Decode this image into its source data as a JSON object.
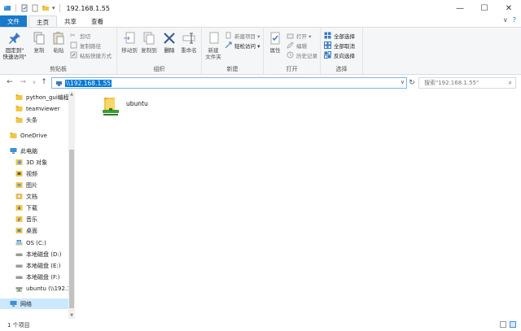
{
  "window": {
    "title": "192.168.1.55",
    "controls": {
      "minimize": "—",
      "maximize": "☐",
      "close": "✕"
    }
  },
  "ribbon_tabs": [
    {
      "label": "文件"
    },
    {
      "label": "主页"
    },
    {
      "label": "共享"
    },
    {
      "label": "查看"
    }
  ],
  "ribbon_right": {
    "collapse": "∨",
    "help": "?"
  },
  "ribbon": {
    "clipboard": {
      "label": "剪贴板",
      "pin": "固定到\"\n快速访问\"",
      "copy": "复制",
      "paste": "粘贴",
      "cut": "剪切",
      "copy_path": "复制路径",
      "paste_shortcut": "粘贴快捷方式"
    },
    "organize": {
      "label": "组织",
      "move_to": "移动到",
      "copy_to": "复制到",
      "delete": "删除",
      "rename": "重命名"
    },
    "new": {
      "label": "新建",
      "new_folder": "新建\n文件夹",
      "new_item": "新建项目 ▾",
      "easy_access": "轻松访问 ▾"
    },
    "open": {
      "label": "打开",
      "properties": "属性",
      "open": "打开 ▾",
      "edit": "编辑",
      "history": "历史记录"
    },
    "select": {
      "label": "选择",
      "select_all": "全部选择",
      "select_none": "全部取消",
      "invert": "反向选择"
    }
  },
  "address": {
    "path": "\\\\192.168.1.55",
    "search_placeholder": "搜索\"192.168.1.55\""
  },
  "nav": {
    "back": "←",
    "forward": "→",
    "recent": "∨",
    "up": "↑",
    "refresh": "↻"
  },
  "tree": [
    {
      "label": "python_gui编程"
    },
    {
      "label": "teamviewer"
    },
    {
      "label": "头条"
    },
    {
      "label": "OneDrive"
    },
    {
      "label": "此电脑"
    },
    {
      "label": "3D 对象"
    },
    {
      "label": "视频"
    },
    {
      "label": "图片"
    },
    {
      "label": "文档"
    },
    {
      "label": "下载"
    },
    {
      "label": "音乐"
    },
    {
      "label": "桌面"
    },
    {
      "label": "OS (C:)"
    },
    {
      "label": "本地磁盘 (D:)"
    },
    {
      "label": "本地磁盘 (E:)"
    },
    {
      "label": "本地磁盘 (F:)"
    },
    {
      "label": "ubuntu (\\\\192.1"
    },
    {
      "label": "网络"
    }
  ],
  "content": {
    "items": [
      {
        "label": "ubuntu"
      }
    ]
  },
  "status": {
    "count": "1 个项目"
  },
  "colors": {
    "accent": "#1979ca",
    "selection": "#cce8ff",
    "folder": "#f3c544"
  }
}
